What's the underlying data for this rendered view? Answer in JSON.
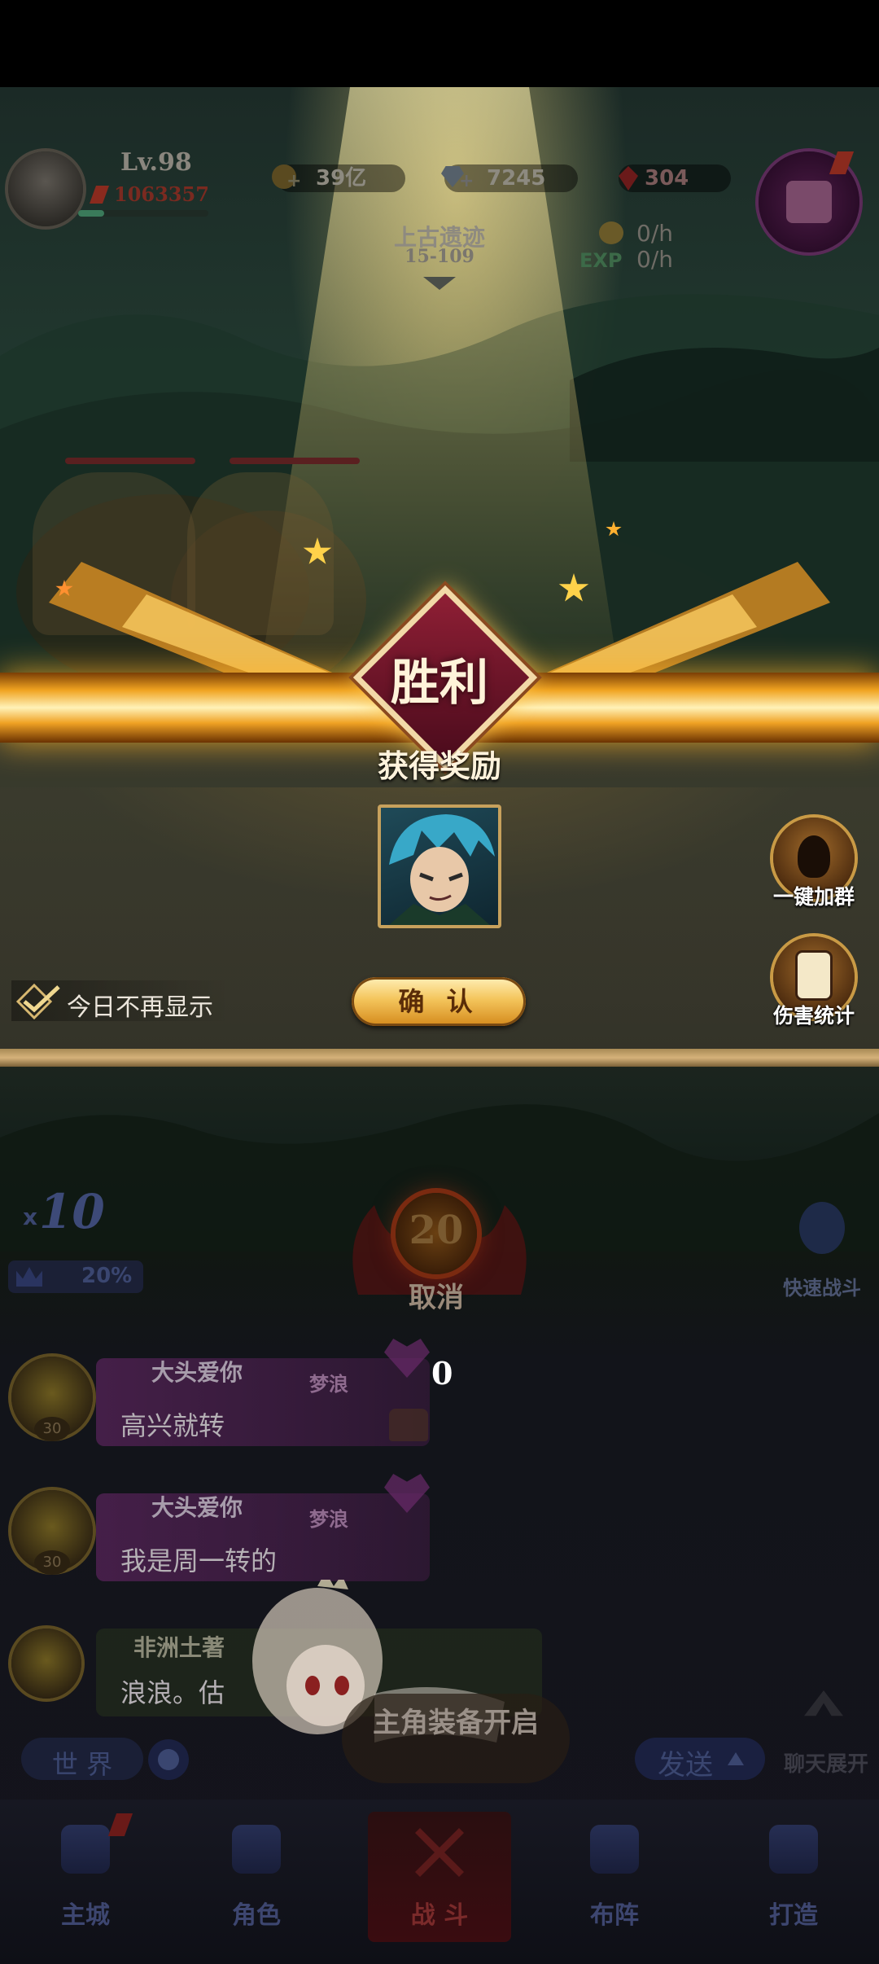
{
  "player": {
    "level": "Lv.98",
    "power": "1063357"
  },
  "currencies": {
    "gold": "39亿",
    "diamonds": "7245",
    "gems": "304"
  },
  "stage": {
    "name": "上古遗迹",
    "number": "15-109"
  },
  "rates": {
    "gold": "0/h",
    "exp_label": "EXP",
    "exp": "0/h"
  },
  "reward_dialog": {
    "victory": "胜利",
    "title": "获得奖励",
    "confirm": "确 认",
    "dont_show_today": "今日不再显示"
  },
  "side_buttons": {
    "join_group": "一键加群",
    "damage_stats": "伤害统计"
  },
  "battle": {
    "speed_prefix": "x",
    "speed": "10",
    "percent": "20%",
    "countdown": "20",
    "cancel": "取消",
    "quick_battle": "快速战斗"
  },
  "chat": {
    "messages": [
      {
        "name": "大头爱你",
        "tag": "梦浪",
        "text": "高兴就转",
        "level": "30"
      },
      {
        "name": "大头爱你",
        "tag": "梦浪",
        "text": "我是周一转的",
        "level": "30"
      },
      {
        "name": "非洲土著",
        "tag": "",
        "text": "浪浪。估",
        "level": ""
      }
    ],
    "unread": "0",
    "channel": "世 界",
    "send": "发送",
    "expand": "聊天展开",
    "notice": "主角装备开启"
  },
  "nav": [
    {
      "label": "主城"
    },
    {
      "label": "角色"
    },
    {
      "label": "战 斗"
    },
    {
      "label": "布阵"
    },
    {
      "label": "打造"
    }
  ],
  "colors": {
    "accent_gold": "#f4c55c",
    "victory_red": "#8f1f35"
  }
}
